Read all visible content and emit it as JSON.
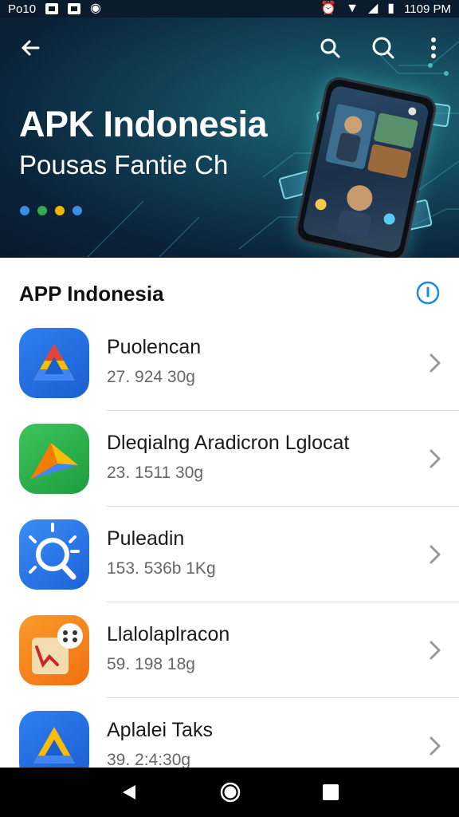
{
  "status_bar": {
    "left_text": "Po10",
    "time": "1109 PM"
  },
  "header": {
    "title": "APK Indonesia",
    "subtitle": "Pousas Fantie Ch",
    "dot_colors": [
      "#3a8ee6",
      "#34a853",
      "#f4b400",
      "#3a8ee6"
    ],
    "icons": [
      "back-arrow-icon",
      "search-icon",
      "search-icon",
      "more-vert-icon"
    ]
  },
  "section": {
    "title": "APP Indonesia",
    "info_icon": "info-icon"
  },
  "apps": [
    {
      "name": "Puolencan",
      "size": "27. 924 30g",
      "icon": "triangle-drive-icon"
    },
    {
      "name": "Dleqialng Aradicron Lglocat",
      "size": "23. 1511 30g",
      "icon": "play-triangle-icon"
    },
    {
      "name": "Puleadin",
      "size": "153. 536b 1Kg",
      "icon": "search-lens-icon"
    },
    {
      "name": "Llalolaplracon",
      "size": "59. 198 18g",
      "icon": "board-game-icon"
    },
    {
      "name": "Aplalei Taks",
      "size": "39. 2:4:30g",
      "icon": "triangle-tasks-icon"
    }
  ],
  "colors": {
    "accent": "#1e88e5",
    "header_bg": "#0a2238"
  }
}
